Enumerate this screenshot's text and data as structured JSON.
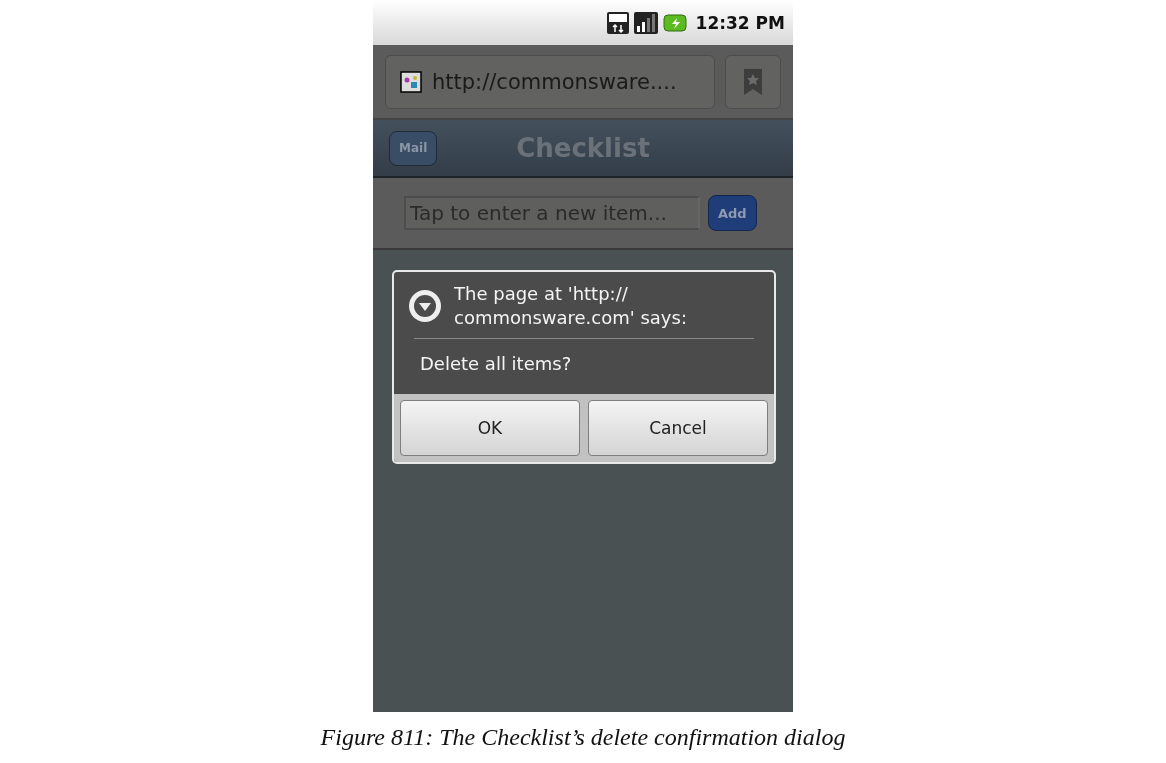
{
  "status_bar": {
    "time": "12:32 PM"
  },
  "browser": {
    "url": "http://commonsware...."
  },
  "app_header": {
    "back_button": "Mail",
    "title": "Checklist"
  },
  "new_item": {
    "placeholder": "Tap to enter a new item...",
    "button": "Add"
  },
  "dialog": {
    "title_lines": [
      "The page at 'http://",
      "commonsware.com' says:"
    ],
    "message": "Delete all items?",
    "buttons": [
      "OK",
      "Cancel"
    ]
  },
  "caption": "Figure 811: The Checklist’s delete confirmation dialog"
}
